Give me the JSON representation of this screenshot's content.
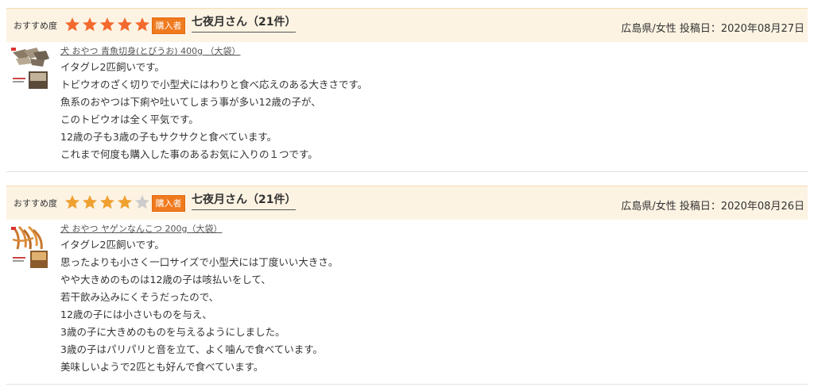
{
  "colors": {
    "header_bg": "#fdf3e3",
    "star_filled": "#f26a2e",
    "star_partial": "#f0a030",
    "star_empty": "#cccccc",
    "buyer_badge_bg": "#f07a1e"
  },
  "reviews": [
    {
      "recommend_label": "おすすめ度",
      "rating": 5,
      "buyer_badge": "購入者",
      "reviewer": "七夜月さん（21件）",
      "meta": "広島県/女性 投稿日：2020年08月27日",
      "product_title": "犬 おやつ 青魚切身(とびうお) 400g （大袋）",
      "thumb_icon": "dried-fish-icon",
      "lines": [
        "イタグレ2匹飼いです。",
        "トビウオのざく切りで小型犬にはわりと食べ応えのある大きさです。",
        "魚系のおやつは下痢や吐いてしまう事が多い12歳の子が、",
        "このトビウオは全く平気です。",
        "12歳の子も3歳の子もサクサクと食べています。",
        "これまで何度も購入した事のあるお気に入りの１つです。"
      ]
    },
    {
      "recommend_label": "おすすめ度",
      "rating": 4,
      "buyer_badge": "購入者",
      "reviewer": "七夜月さん（21件）",
      "meta": "広島県/女性 投稿日：2020年08月26日",
      "product_title": "犬 おやつ ヤゲンなんこつ 200g（大袋）",
      "thumb_icon": "chicken-cartilage-icon",
      "lines": [
        "イタグレ2匹飼いです。",
        "思ったよりも小さく一口サイズで小型犬には丁度いい大きさ。",
        "やや大きめのものは12歳の子は咳払いをして、",
        "若干飲み込みにくそうだったので、",
        "12歳の子には小さいものを与え、",
        "3歳の子に大きめのものを与えるようにしました。",
        "3歳の子はパリパリと音を立て、よく噛んで食べています。",
        "美味しいようで2匹とも好んで食べています。"
      ]
    }
  ]
}
